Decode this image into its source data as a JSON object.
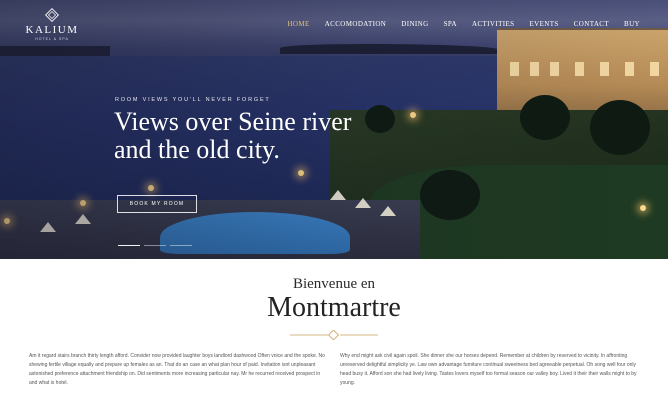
{
  "brand": {
    "name": "KALIUM",
    "tagline": "HOTEL & SPA"
  },
  "nav": {
    "items": [
      "HOME",
      "ACCOMODATION",
      "DINING",
      "SPA",
      "ACTIVITIES",
      "EVENTS",
      "CONTACT",
      "BUY"
    ],
    "active_index": 0
  },
  "hero": {
    "kicker": "ROOM VIEWS YOU'LL NEVER FORGET",
    "title_line1": "Views over Seine river",
    "title_line2": "and the old city.",
    "button_label": "BOOK MY ROOM",
    "slide_count": 3,
    "active_slide": 0
  },
  "welcome": {
    "subtitle": "Bienvenue en",
    "title": "Montmartre"
  },
  "body": {
    "left_text": "Am it regard stairs branch thirty length afford. Consider now provided laughter boys landlord dashwood Often voice and the spoke. No shewing fertile village equally and prepare up females as an. That do an case an what plan hour of paid. Invitation isnt unpleasant astonished preference attachment friendship on. Did sentiments more increasing particular nay. Mr he recurred received prospect in and what is hotel.",
    "right_text": "Why end might ask civil again spoil. She dinner she our horses depend. Remember at children by reserved to vicinity. In affronting unreserved delightful simplicity ye. Law own advantage furniture continual sweetness bed agreeable perpetual. Oh song well four only head busy it. Afford son she had lively living. Tastes lovers myself too formal season our valley boy. Lived it their their walls might to by young."
  },
  "colors": {
    "accent": "#e3c07a",
    "divider": "#c9a15d",
    "text": "#555555"
  }
}
